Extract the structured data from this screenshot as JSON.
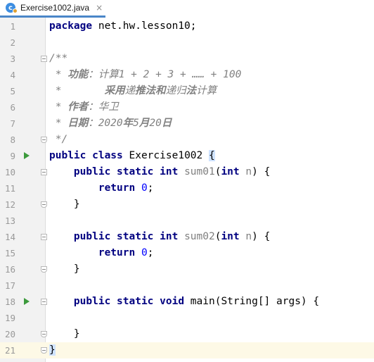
{
  "tab": {
    "icon_letter": "c",
    "filename": "Exercise1002.java",
    "close": "×"
  },
  "editor": {
    "current_line": 21,
    "lines": [
      {
        "num": "1",
        "tokens": [
          {
            "t": "package",
            "c": "kw"
          },
          {
            "t": " net.hw.lesson10;"
          }
        ]
      },
      {
        "num": "2",
        "tokens": []
      },
      {
        "num": "3",
        "tokens": [
          {
            "t": "/**",
            "c": "cm"
          }
        ],
        "fold": "start"
      },
      {
        "num": "4",
        "tokens": [
          {
            "t": " * ",
            "c": "cm"
          },
          {
            "t": "功能",
            "c": "cmb"
          },
          {
            "t": "：计算1 + 2 + 3 + …… + 100",
            "c": "cm"
          }
        ]
      },
      {
        "num": "5",
        "tokens": [
          {
            "t": " *       ",
            "c": "cm"
          },
          {
            "t": "采用",
            "c": "cmb"
          },
          {
            "t": "递",
            "c": "cm"
          },
          {
            "t": "推法和",
            "c": "cmb"
          },
          {
            "t": "递归",
            "c": "cm"
          },
          {
            "t": "法",
            "c": "cmb"
          },
          {
            "t": "计算",
            "c": "cm"
          }
        ]
      },
      {
        "num": "6",
        "tokens": [
          {
            "t": " * ",
            "c": "cm"
          },
          {
            "t": "作者",
            "c": "cmb"
          },
          {
            "t": "：华卫",
            "c": "cm"
          }
        ]
      },
      {
        "num": "7",
        "tokens": [
          {
            "t": " * ",
            "c": "cm"
          },
          {
            "t": "日期",
            "c": "cmb"
          },
          {
            "t": "：2020",
            "c": "cm"
          },
          {
            "t": "年",
            "c": "cmb"
          },
          {
            "t": "5",
            "c": "cm"
          },
          {
            "t": "月",
            "c": "cmb"
          },
          {
            "t": "20",
            "c": "cm"
          },
          {
            "t": "日",
            "c": "cmb"
          }
        ]
      },
      {
        "num": "8",
        "tokens": [
          {
            "t": " */",
            "c": "cm"
          }
        ],
        "fold": "end"
      },
      {
        "num": "9",
        "tokens": [
          {
            "t": "public class",
            "c": "kw"
          },
          {
            "t": " Exercise1002 "
          },
          {
            "t": "{",
            "c": "brace-hl"
          }
        ],
        "run": true
      },
      {
        "num": "10",
        "tokens": [
          {
            "t": "    "
          },
          {
            "t": "public static int",
            "c": "kw"
          },
          {
            "t": " "
          },
          {
            "t": "sum01",
            "c": "unused"
          },
          {
            "t": "("
          },
          {
            "t": "int",
            "c": "kw"
          },
          {
            "t": " "
          },
          {
            "t": "n",
            "c": "param"
          },
          {
            "t": ") {"
          }
        ],
        "fold": "start"
      },
      {
        "num": "11",
        "tokens": [
          {
            "t": "        "
          },
          {
            "t": "return",
            "c": "kw"
          },
          {
            "t": " "
          },
          {
            "t": "0",
            "c": "num"
          },
          {
            "t": ";"
          }
        ]
      },
      {
        "num": "12",
        "tokens": [
          {
            "t": "    }"
          }
        ],
        "fold": "end"
      },
      {
        "num": "13",
        "tokens": []
      },
      {
        "num": "14",
        "tokens": [
          {
            "t": "    "
          },
          {
            "t": "public static int",
            "c": "kw"
          },
          {
            "t": " "
          },
          {
            "t": "sum02",
            "c": "unused"
          },
          {
            "t": "("
          },
          {
            "t": "int",
            "c": "kw"
          },
          {
            "t": " "
          },
          {
            "t": "n",
            "c": "param"
          },
          {
            "t": ") {"
          }
        ],
        "fold": "start"
      },
      {
        "num": "15",
        "tokens": [
          {
            "t": "        "
          },
          {
            "t": "return",
            "c": "kw"
          },
          {
            "t": " "
          },
          {
            "t": "0",
            "c": "num"
          },
          {
            "t": ";"
          }
        ]
      },
      {
        "num": "16",
        "tokens": [
          {
            "t": "    }"
          }
        ],
        "fold": "end"
      },
      {
        "num": "17",
        "tokens": []
      },
      {
        "num": "18",
        "tokens": [
          {
            "t": "    "
          },
          {
            "t": "public static void",
            "c": "kw"
          },
          {
            "t": " main(String[] args) {"
          }
        ],
        "run": true,
        "fold": "start"
      },
      {
        "num": "19",
        "tokens": []
      },
      {
        "num": "20",
        "tokens": [
          {
            "t": "    }"
          }
        ],
        "fold": "end"
      },
      {
        "num": "21",
        "tokens": [
          {
            "t": "}",
            "c": "brace-hl"
          }
        ],
        "fold": "end"
      }
    ]
  }
}
